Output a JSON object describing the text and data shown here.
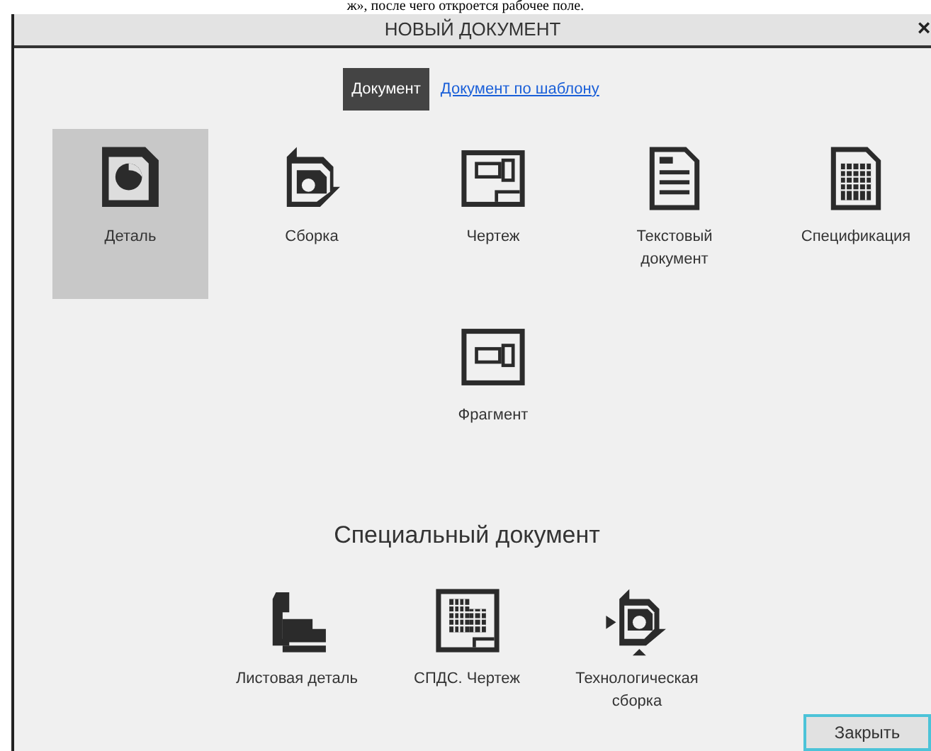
{
  "background_text": "ж», после чего откроется рабочее поле.",
  "window": {
    "title": "НОВЫЙ ДОКУМЕНТ",
    "close": "×"
  },
  "tabs": [
    {
      "label": "Документ",
      "selected": true
    },
    {
      "label": "Документ по шаблону",
      "selected": false
    }
  ],
  "documents": [
    {
      "kind": "part",
      "label": "Деталь",
      "selected": true
    },
    {
      "kind": "assembly",
      "label": "Сборка",
      "selected": false
    },
    {
      "kind": "drawing",
      "label": "Чертеж",
      "selected": false
    },
    {
      "kind": "text",
      "label": "Текстовый документ",
      "selected": false
    },
    {
      "kind": "spec",
      "label": "Спецификация",
      "selected": false
    },
    {
      "kind": "fragment",
      "label": "Фрагмент",
      "selected": false
    }
  ],
  "special_heading": "Специальный документ",
  "special_documents": [
    {
      "kind": "sheet",
      "label": "Листовая деталь",
      "selected": false
    },
    {
      "kind": "spds",
      "label": "СПДС. Чертеж",
      "selected": false
    },
    {
      "kind": "tech",
      "label": "Технологическая сборка",
      "selected": false
    }
  ],
  "buttons": [
    "Закрыть"
  ]
}
